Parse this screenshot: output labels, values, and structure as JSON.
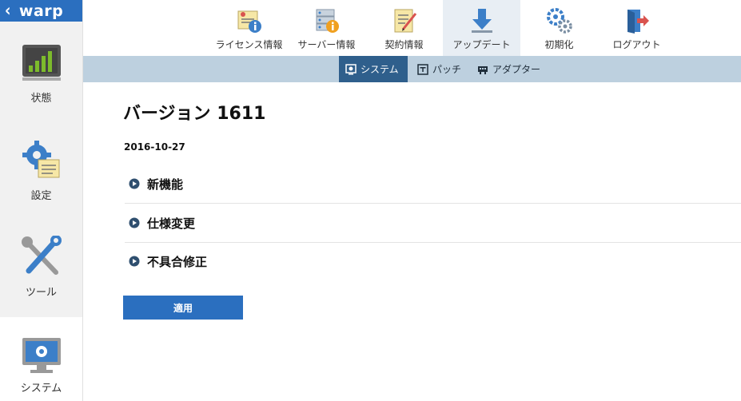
{
  "brand": {
    "name": "warp"
  },
  "sidebar": {
    "items": [
      {
        "label": "状態",
        "icon": "bar-chart-icon"
      },
      {
        "label": "設定",
        "icon": "gear-settings-icon"
      },
      {
        "label": "ツール",
        "icon": "tools-icon"
      },
      {
        "label": "システム",
        "icon": "monitor-gear-icon"
      }
    ]
  },
  "tabs": [
    {
      "label": "ライセンス情報",
      "icon": "license-info-icon"
    },
    {
      "label": "サーバー情報",
      "icon": "server-info-icon"
    },
    {
      "label": "契約情報",
      "icon": "contract-icon"
    },
    {
      "label": "アップデート",
      "icon": "download-icon"
    },
    {
      "label": "初期化",
      "icon": "gears-icon"
    },
    {
      "label": "ログアウト",
      "icon": "logout-icon"
    }
  ],
  "subtabs": [
    {
      "label": "システム",
      "icon": "system-icon"
    },
    {
      "label": "パッチ",
      "icon": "patch-icon"
    },
    {
      "label": "アダプター",
      "icon": "adapter-icon"
    }
  ],
  "content": {
    "title": "バージョン 1611",
    "date": "2016-10-27",
    "sections": [
      {
        "label": "新機能"
      },
      {
        "label": "仕様変更"
      },
      {
        "label": "不具合修正"
      }
    ],
    "apply_label": "適用"
  },
  "colors": {
    "accent": "#2b6fbf",
    "subnav_bg": "#bdd0df",
    "subnav_active": "#2f5f8c"
  }
}
